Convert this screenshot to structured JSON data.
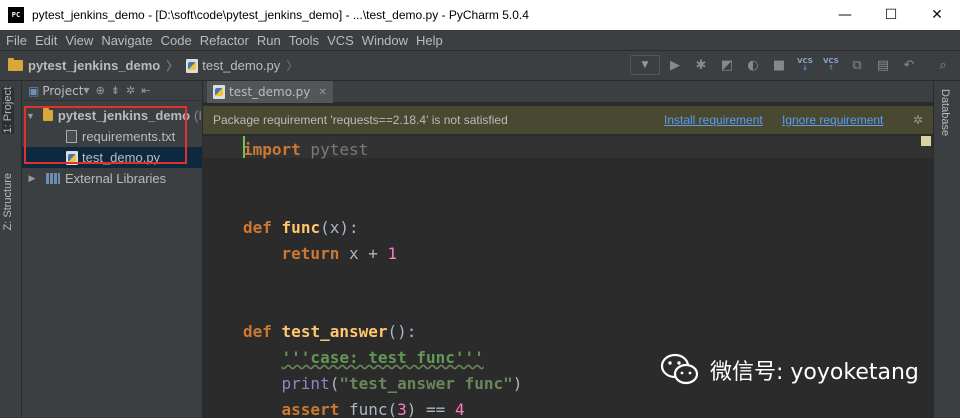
{
  "window": {
    "title": "pytest_jenkins_demo - [D:\\soft\\code\\pytest_jenkins_demo] - ...\\test_demo.py - PyCharm 5.0.4",
    "app_icon_text": "PC",
    "controls": {
      "minimize": "—",
      "maximize": "☐",
      "close": "✕"
    }
  },
  "menu": [
    "File",
    "Edit",
    "View",
    "Navigate",
    "Code",
    "Refactor",
    "Run",
    "Tools",
    "VCS",
    "Window",
    "Help"
  ],
  "navbar": {
    "crumbs": [
      "pytest_jenkins_demo",
      "test_demo.py"
    ],
    "separator": "〉",
    "vcs_label": "VCS"
  },
  "tool_windows": {
    "left": [
      "1: Project",
      "Z: Structure"
    ],
    "right": [
      "Database"
    ]
  },
  "project_panel": {
    "header": "Project",
    "tree": [
      {
        "label": "pytest_jenkins_demo",
        "suffix": "(I"
      },
      {
        "label": "requirements.txt"
      },
      {
        "label": "test_demo.py"
      },
      {
        "label": "External Libraries"
      }
    ]
  },
  "editor": {
    "tab": "test_demo.py",
    "notification": {
      "message": "Package requirement 'requests==2.18.4' is not satisfied",
      "install": "Install requirement",
      "ignore": "Ignore requirement"
    },
    "code": {
      "l1_kw": "import",
      "l1_rest": " pytest",
      "l2_kw": "def",
      "l2_fn": "func",
      "l2_rest": "(x):",
      "l3_kw": "return",
      "l3_a": " x + ",
      "l3_num": "1",
      "l4_kw": "def",
      "l4_fn": "test_answer",
      "l4_rest": "():",
      "l5_str": "'''case: test func'''",
      "l6_fn": "print",
      "l6_p1": "(",
      "l6_str": "\"test_answer func\"",
      "l6_p2": ")",
      "l7_kw": "assert",
      "l7_a": " func(",
      "l7_num": "3",
      "l7_b": ") == ",
      "l7_num2": "4"
    }
  },
  "watermark": {
    "text": "微信号: yoyoketang"
  }
}
